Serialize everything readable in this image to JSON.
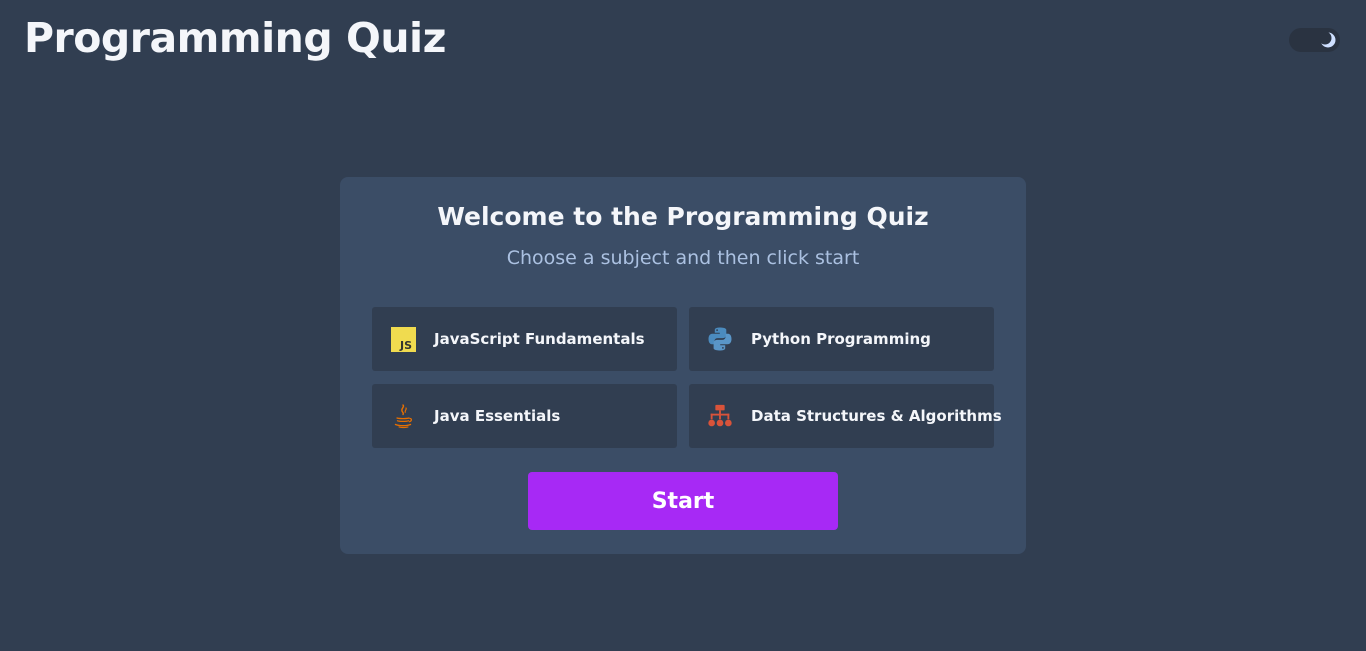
{
  "header": {
    "title": "Programming Quiz",
    "theme_toggle_icon": "moon-icon"
  },
  "card": {
    "title": "Welcome to the Programming Quiz",
    "subtitle": "Choose a subject and then click start"
  },
  "subjects": [
    {
      "label": "JavaScript Fundamentals",
      "icon": "javascript-icon"
    },
    {
      "label": "Python Programming",
      "icon": "python-icon"
    },
    {
      "label": "Java Essentials",
      "icon": "java-icon"
    },
    {
      "label": "Data Structures & Algorithms",
      "icon": "sitemap-icon"
    }
  ],
  "start_button": {
    "label": "Start"
  },
  "colors": {
    "background": "#313e51",
    "card": "#3b4d66",
    "accent": "#a729f5",
    "subtitle": "#abc1e1",
    "js_yellow": "#f0db4f",
    "python_blue": "#4b8bbe",
    "java_orange": "#e76f00",
    "dsa_red": "#d9533a"
  }
}
